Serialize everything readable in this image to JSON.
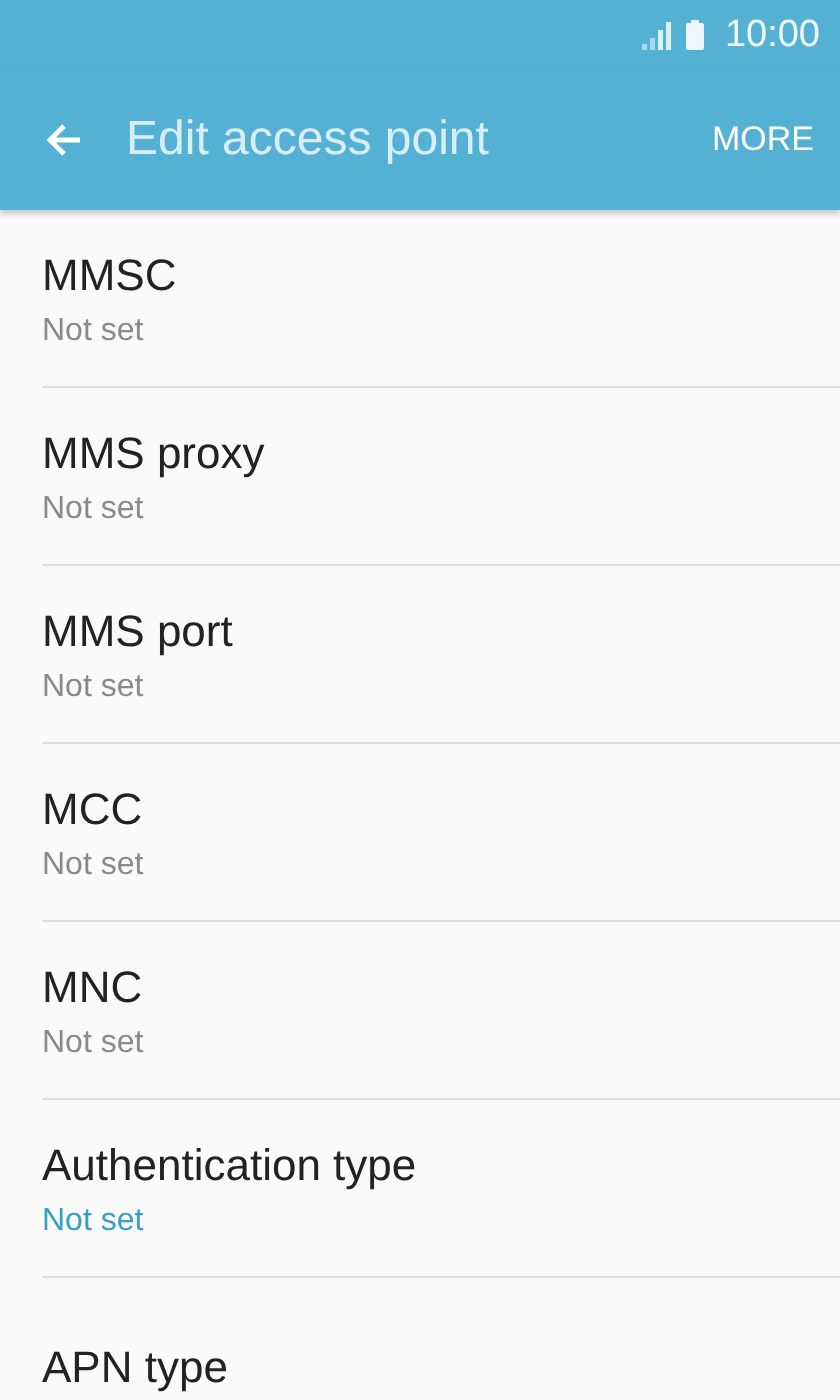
{
  "status_bar": {
    "time": "10:00"
  },
  "app_bar": {
    "title": "Edit access point",
    "action": "MORE"
  },
  "settings": [
    {
      "title": "MMSC",
      "value": "Not set",
      "highlighted": false
    },
    {
      "title": "MMS proxy",
      "value": "Not set",
      "highlighted": false
    },
    {
      "title": "MMS port",
      "value": "Not set",
      "highlighted": false
    },
    {
      "title": "MCC",
      "value": "Not set",
      "highlighted": false
    },
    {
      "title": "MNC",
      "value": "Not set",
      "highlighted": false
    },
    {
      "title": "Authentication type",
      "value": "Not set",
      "highlighted": true
    },
    {
      "title": "APN type"
    }
  ]
}
